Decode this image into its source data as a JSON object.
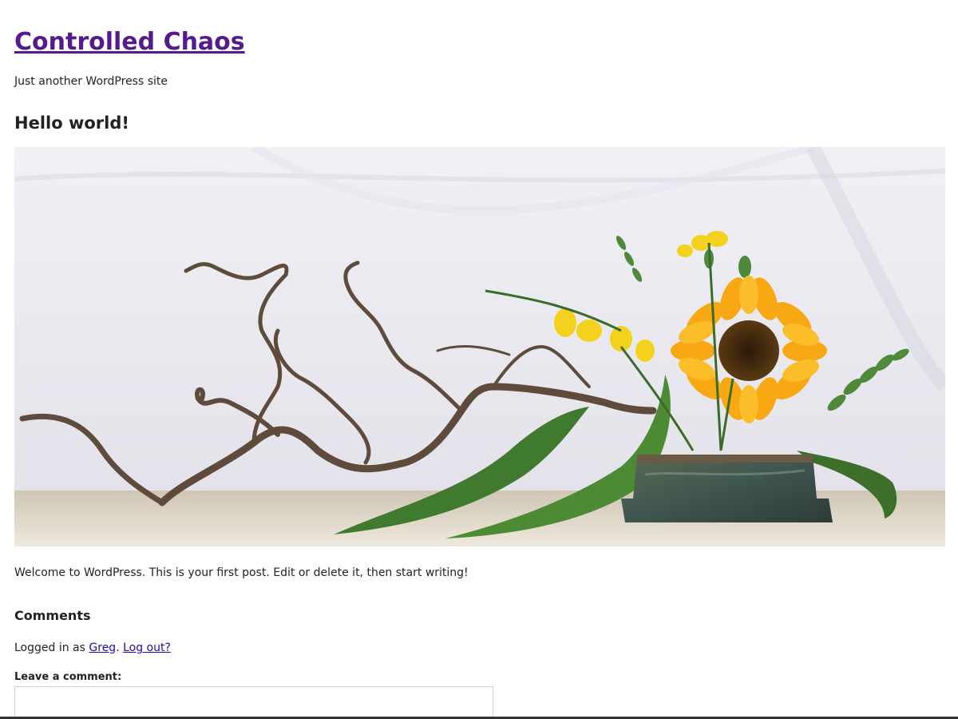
{
  "site": {
    "title": "Controlled Chaos",
    "tagline": "Just another WordPress site"
  },
  "post": {
    "title": "Hello world!",
    "image": {
      "subject": "ikebana-arrangement",
      "background_color": "#ecebf1",
      "table_color": "#d8cfc0",
      "branch_color": "#5a4a3a",
      "petal_color": "#f7a812",
      "leaf_color": "#3f7a2f",
      "pot_color": "#4a5a48"
    },
    "body": "Welcome to WordPress. This is your first post. Edit or delete it, then start writing!"
  },
  "comments": {
    "heading": "Comments",
    "logged_in_prefix": "Logged in as ",
    "user_name": "Greg",
    "separator": ". ",
    "logout_label": "Log out?",
    "leave_label": "Leave a comment:",
    "textarea_value": ""
  },
  "colors": {
    "link_visited": "#551a8b",
    "link": "#1a0dab",
    "text": "#222222"
  }
}
